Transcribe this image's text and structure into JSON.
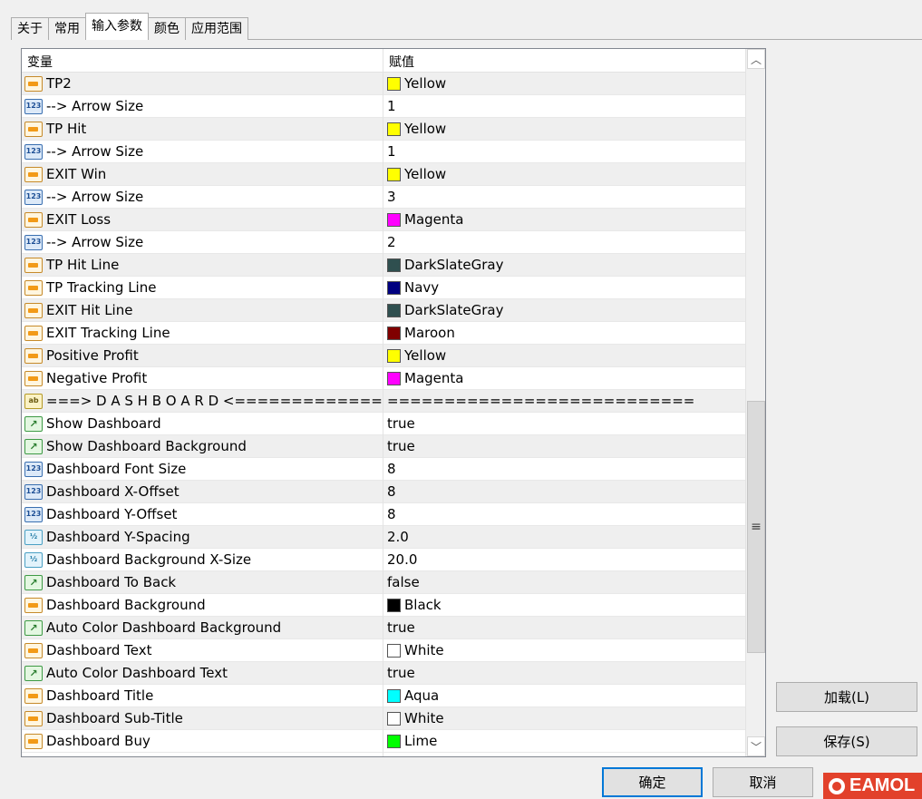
{
  "tabs": [
    "关于",
    "常用",
    "输入参数",
    "颜色",
    "应用范围"
  ],
  "active_tab": 2,
  "table": {
    "header": {
      "variable": "变量",
      "value": "赋值"
    },
    "rows": [
      {
        "type": "color",
        "name": "TP2",
        "value": "Yellow",
        "swatch": "#ffff00"
      },
      {
        "type": "int",
        "name": "--> Arrow Size",
        "value": "1"
      },
      {
        "type": "color",
        "name": "TP Hit",
        "value": "Yellow",
        "swatch": "#ffff00"
      },
      {
        "type": "int",
        "name": "--> Arrow Size",
        "value": "1"
      },
      {
        "type": "color",
        "name": "EXIT Win",
        "value": "Yellow",
        "swatch": "#ffff00"
      },
      {
        "type": "int",
        "name": "--> Arrow Size",
        "value": "3"
      },
      {
        "type": "color",
        "name": "EXIT Loss",
        "value": "Magenta",
        "swatch": "#ff00ff"
      },
      {
        "type": "int",
        "name": "--> Arrow Size",
        "value": "2"
      },
      {
        "type": "color",
        "name": "TP Hit Line",
        "value": "DarkSlateGray",
        "swatch": "#2f4f4f"
      },
      {
        "type": "color",
        "name": "TP Tracking Line",
        "value": "Navy",
        "swatch": "#000080"
      },
      {
        "type": "color",
        "name": "EXIT Hit Line",
        "value": "DarkSlateGray",
        "swatch": "#2f4f4f"
      },
      {
        "type": "color",
        "name": "EXIT Tracking Line",
        "value": "Maroon",
        "swatch": "#800000"
      },
      {
        "type": "color",
        "name": "Positive Profit",
        "value": "Yellow",
        "swatch": "#ffff00"
      },
      {
        "type": "color",
        "name": "Negative Profit",
        "value": "Magenta",
        "swatch": "#ff00ff"
      },
      {
        "type": "str",
        "name": "===> D A S H B O A R D <===============...",
        "value": "==========================="
      },
      {
        "type": "bool",
        "name": "Show Dashboard",
        "value": "true"
      },
      {
        "type": "bool",
        "name": "Show Dashboard Background",
        "value": "true"
      },
      {
        "type": "int",
        "name": "Dashboard Font Size",
        "value": "8"
      },
      {
        "type": "int",
        "name": "Dashboard X-Offset",
        "value": "8"
      },
      {
        "type": "int",
        "name": "Dashboard Y-Offset",
        "value": "8"
      },
      {
        "type": "dbl",
        "name": "Dashboard Y-Spacing",
        "value": "2.0"
      },
      {
        "type": "dbl",
        "name": "Dashboard Background X-Size",
        "value": "20.0"
      },
      {
        "type": "bool",
        "name": "Dashboard To Back",
        "value": "false"
      },
      {
        "type": "color",
        "name": "Dashboard Background",
        "value": "Black",
        "swatch": "#000000"
      },
      {
        "type": "bool",
        "name": "Auto Color Dashboard Background",
        "value": "true"
      },
      {
        "type": "color",
        "name": "Dashboard Text",
        "value": "White",
        "swatch": "#ffffff"
      },
      {
        "type": "bool",
        "name": "Auto Color Dashboard Text",
        "value": "true"
      },
      {
        "type": "color",
        "name": "Dashboard Title",
        "value": "Aqua",
        "swatch": "#00ffff"
      },
      {
        "type": "color",
        "name": "Dashboard Sub-Title",
        "value": "White",
        "swatch": "#ffffff"
      },
      {
        "type": "color",
        "name": "Dashboard Buy",
        "value": "Lime",
        "swatch": "#00ff00"
      }
    ]
  },
  "icons": {
    "color": "color-param-icon",
    "int": "integer-param-icon",
    "dbl": "double-param-icon",
    "bool": "bool-param-icon",
    "str": "string-param-icon"
  },
  "icon_text": {
    "int": "123",
    "dbl": "½",
    "bool": "↗",
    "str": "ab"
  },
  "buttons": {
    "load": "加载(L)",
    "save": "保存(S)",
    "ok": "确定",
    "cancel": "取消"
  },
  "brand": "EAMOL",
  "colors": {
    "accent": "#0078d7",
    "brand": "#e2412b"
  }
}
